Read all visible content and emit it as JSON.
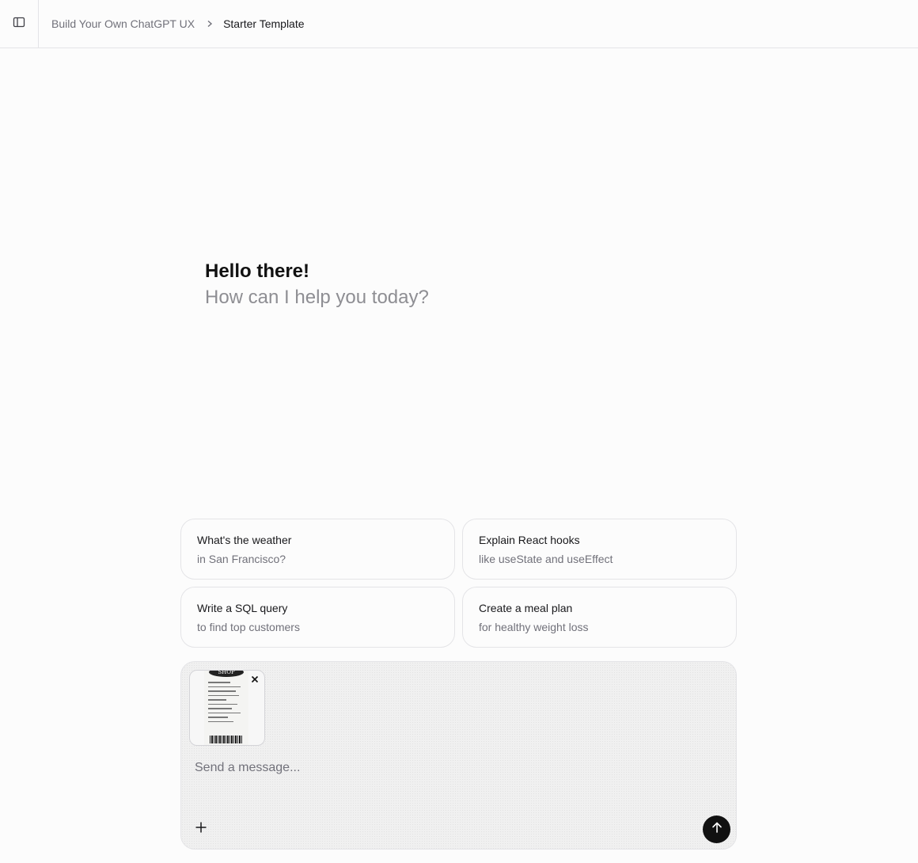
{
  "header": {
    "breadcrumb": {
      "parent": "Build Your Own ChatGPT UX",
      "current": "Starter Template"
    }
  },
  "greeting": {
    "title": "Hello there!",
    "subtitle": "How can I help you today?"
  },
  "suggestions": [
    {
      "title": "What's the weather",
      "subtitle": "in San Francisco?"
    },
    {
      "title": "Explain React hooks",
      "subtitle": "like useState and useEffect"
    },
    {
      "title": "Write a SQL query",
      "subtitle": "to find top customers"
    },
    {
      "title": "Create a meal plan",
      "subtitle": "for healthy weight loss"
    }
  ],
  "composer": {
    "placeholder": "Send a message...",
    "attachment": {
      "label": "SHOP",
      "icon": "receipt-image"
    },
    "icons": {
      "add": "plus-icon",
      "send": "arrow-up-icon",
      "remove": "close-icon"
    }
  },
  "colors": {
    "send_button": "#111111",
    "border": "#e4e4e7",
    "muted_text": "#71717a"
  }
}
